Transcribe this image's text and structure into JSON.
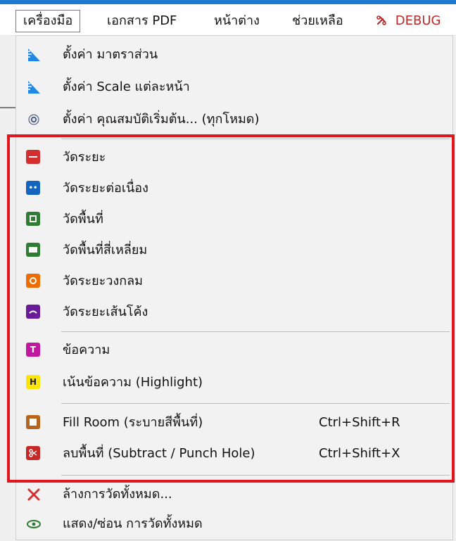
{
  "menubar": {
    "items": [
      {
        "label": "เครื่องมือ"
      },
      {
        "label": "เอกสาร PDF"
      },
      {
        "label": "หน้าต่าง"
      },
      {
        "label": "ช่วยเหลือ"
      },
      {
        "label": "DEBUG"
      }
    ]
  },
  "menu": {
    "items": [
      {
        "label": "ตั้งค่า มาตราส่วน",
        "icon": "scale-ruler-icon"
      },
      {
        "label": "ตั้งค่า Scale แต่ละหน้า",
        "icon": "scale-ruler-icon"
      },
      {
        "label": "ตั้งค่า คุณสมบัติเริ่มต้น... (ทุกโหมด)",
        "icon": "settings-gear-icon"
      },
      {
        "label": "วัดระยะ",
        "icon": "measure-distance-icon",
        "color": "#d32f2f"
      },
      {
        "label": "วัดระยะต่อเนื่อง",
        "icon": "measure-polyline-icon",
        "color": "#1565c0"
      },
      {
        "label": "วัดพื้นที่",
        "icon": "measure-area-icon",
        "color": "#2e7d32"
      },
      {
        "label": "วัดพื้นที่สี่เหลี่ยม",
        "icon": "measure-rectangle-icon",
        "color": "#2e7d32"
      },
      {
        "label": "วัดระยะวงกลม",
        "icon": "measure-circle-icon",
        "color": "#ef6c00"
      },
      {
        "label": "วัดระยะเส้นโค้ง",
        "icon": "measure-curve-icon",
        "color": "#6a1b9a"
      },
      {
        "label": "ข้อความ",
        "icon": "text-icon",
        "color": "#c2189f"
      },
      {
        "label": "เน้นข้อความ (Highlight)",
        "icon": "highlight-icon",
        "color": "#ffe600"
      },
      {
        "label": "Fill Room  (ระบายสีพื้นที่)",
        "shortcut": "Ctrl+Shift+R",
        "icon": "fill-room-icon",
        "color": "#b5651d"
      },
      {
        "label": "ลบพื้นที่  (Subtract / Punch Hole)",
        "shortcut": "Ctrl+Shift+X",
        "icon": "scissors-icon",
        "color": "#c62828"
      },
      {
        "label": "ล้างการวัดทั้งหมด...",
        "icon": "clear-x-icon",
        "color": "#d32f2f"
      },
      {
        "label": "แสดง/ซ่อน การวัดทั้งหมด",
        "icon": "eye-icon",
        "color": "#2e7d32"
      }
    ]
  },
  "colors": {
    "accent_bar": "#1f78d1",
    "highlight_border": "#e0161c",
    "debug_text": "#c0282a"
  }
}
